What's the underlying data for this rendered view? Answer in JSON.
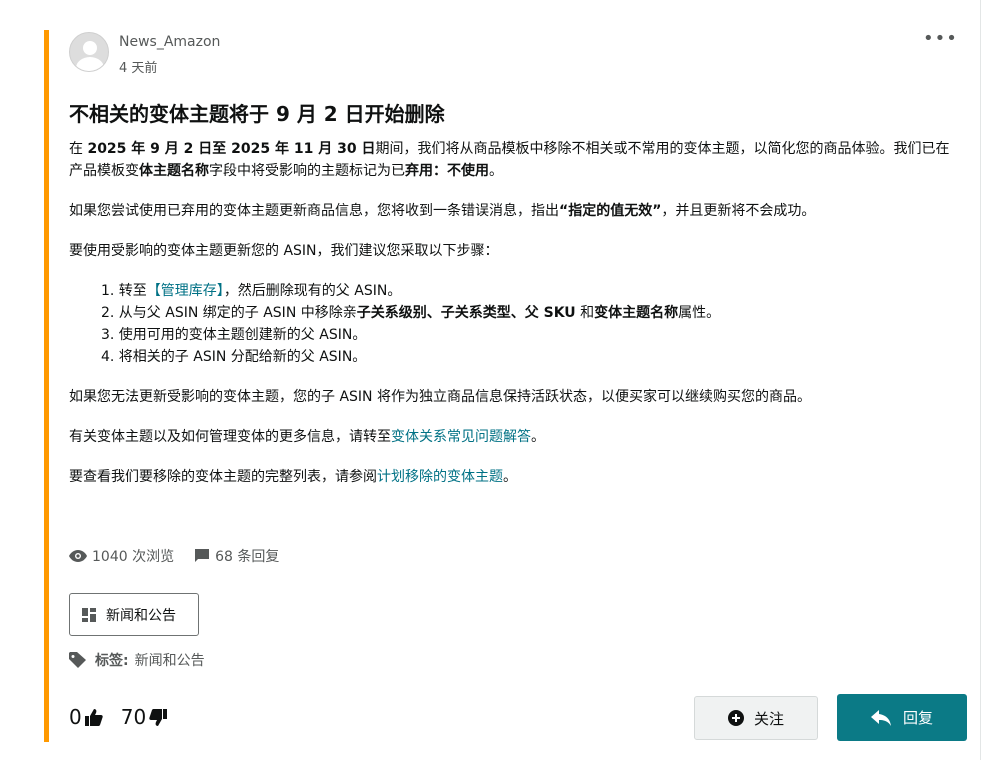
{
  "post": {
    "author": "News_Amazon",
    "time": "4 天前",
    "more_label": "•••",
    "title": "不相关的变体主题将于 9 月 2 日开始删除",
    "para1": {
      "t1": "在 ",
      "b1": "2025 年 9 月 2 日至 2025 年 11 月 30 日",
      "t2": "期间，我们将从商品模板中移除不相关或不常用的变体主题，以简化您的商品体验。我们已在产品模板变",
      "b2": "体主题名称",
      "t3": "字段中将受影响的主题标记为已",
      "b3": "弃用：不使用",
      "t4": "。"
    },
    "para2": {
      "t1": "如果您尝试使用已弃用的变体主题更新商品信息，您将收到一条错误消息，指出",
      "b1": "“指定的值无效”",
      "t2": "，并且更新将不会成功。"
    },
    "para3": "要使用受影响的变体主题更新您的 ASIN，我们建议您采取以下步骤：",
    "steps": {
      "s1": {
        "t1": "1. 转至",
        "link": "【管理库存】",
        "t2": "，然后删除现有的父 ASIN。"
      },
      "s2": {
        "t1": "2. 从与父 ASIN 绑定的子 ASIN 中移除亲",
        "b1": "子关系级别、子关系类型、父 SKU",
        "t2": " 和",
        "b2": "变体主题名称",
        "t3": "属性。"
      },
      "s3": "3. 使用可用的变体主题创建新的父 ASIN。",
      "s4": "4. 将相关的子 ASIN 分配给新的父 ASIN。"
    },
    "para4": "如果您无法更新受影响的变体主题，您的子 ASIN 将作为独立商品信息保持活跃状态，以便买家可以继续购买您的商品。",
    "para5": {
      "t1": "有关变体主题以及如何管理变体的更多信息，请转至",
      "link": "变体关系常见问题解答",
      "t2": "。"
    },
    "para6": {
      "t1": "要查看我们要移除的变体主题的完整列表，请参阅",
      "link": "计划移除的变体主题",
      "t2": "。"
    }
  },
  "stats": {
    "views": "1040 次浏览",
    "replies": "68 条回复"
  },
  "category": {
    "label": "新闻和公告"
  },
  "tags": {
    "label": "标签:",
    "value": "新闻和公告"
  },
  "votes": {
    "up": "0",
    "down": "70"
  },
  "actions": {
    "follow": "关注",
    "reply": "回复"
  },
  "colors": {
    "accent": "#ff9900",
    "link": "#007185",
    "primary_button": "#0b7a86"
  },
  "icons": [
    "avatar",
    "more-icon",
    "eye-icon",
    "comment-icon",
    "category-icon",
    "tag-icon",
    "thumbs-up-icon",
    "thumbs-down-icon",
    "plus-circle-icon",
    "reply-arrow-icon"
  ]
}
